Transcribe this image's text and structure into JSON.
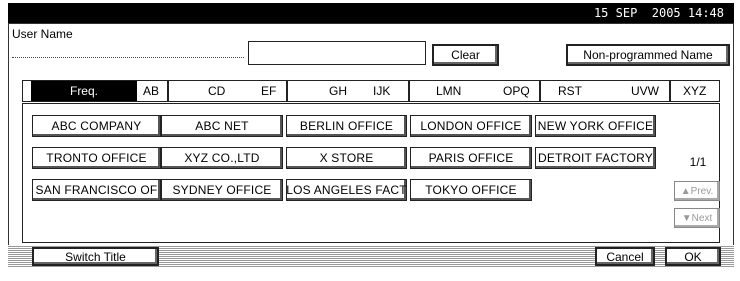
{
  "header": {
    "datetime": "15 SEP  2005 14:48"
  },
  "user_name": {
    "label": "User Name",
    "value": "",
    "clear_label": "Clear",
    "non_programmed_label": "Non-programmed Name"
  },
  "tabs": [
    {
      "label": "Freq.",
      "suffix": "AB"
    },
    {
      "label": "CD",
      "suffix": "EF"
    },
    {
      "label": "GH",
      "suffix": "IJK"
    },
    {
      "label": "LMN",
      "suffix": "OPQ"
    },
    {
      "label": "RST",
      "suffix": "UVW"
    },
    {
      "label": "XYZ",
      "suffix": ""
    }
  ],
  "entries": {
    "row1": [
      "ABC COMPANY",
      "ABC NET",
      "BERLIN OFFICE",
      "LONDON OFFICE",
      "NEW YORK OFFICE"
    ],
    "row2": [
      "TRONTO OFFICE",
      "XYZ CO.,LTD",
      "X STORE",
      "PARIS OFFICE",
      "DETROIT FACTORY"
    ],
    "row3": [
      "SAN FRANCISCO OF",
      "SYDNEY OFFICE",
      "LOS ANGELES FACT",
      "TOKYO OFFICE"
    ]
  },
  "pager": {
    "page": "1/1",
    "prev_label": "▲Prev.",
    "next_label": "▼Next"
  },
  "footer": {
    "switch_title_label": "Switch Title",
    "cancel_label": "Cancel",
    "ok_label": "OK"
  }
}
